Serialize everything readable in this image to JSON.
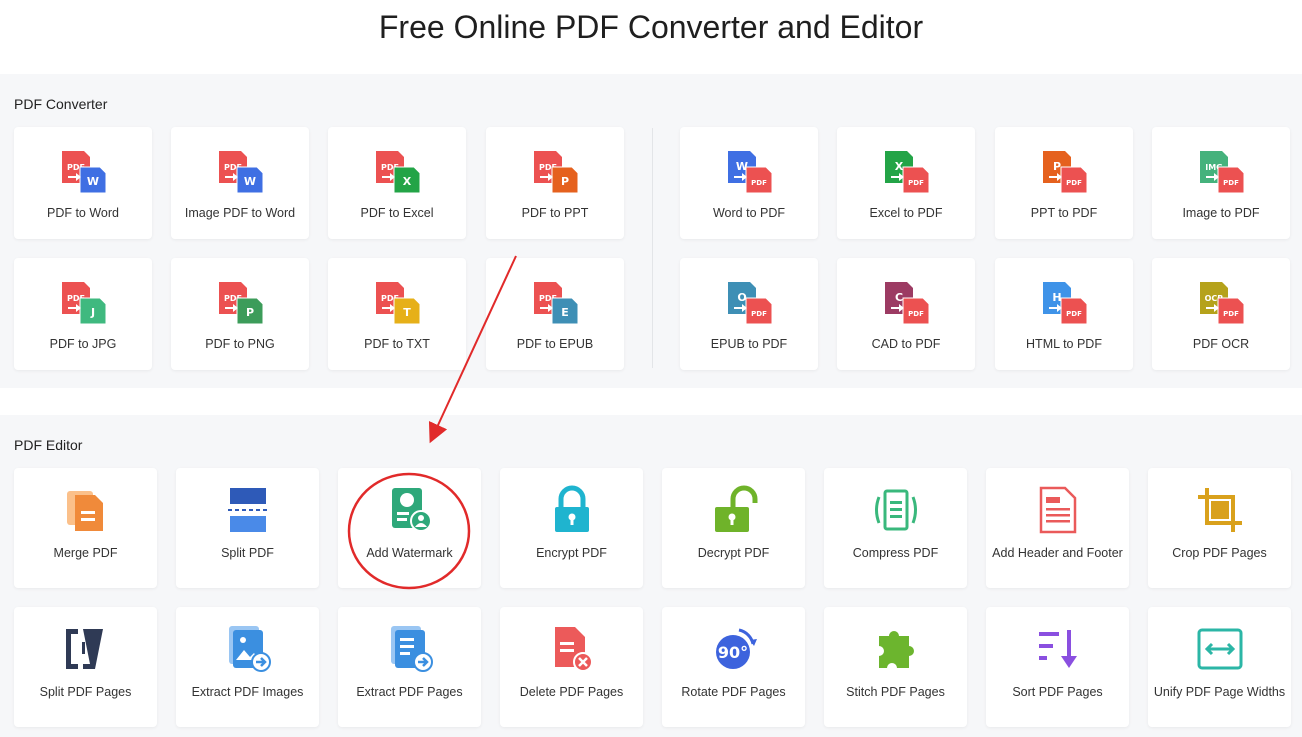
{
  "page": {
    "title": "Free Online PDF Converter and Editor"
  },
  "converter": {
    "title": "PDF Converter",
    "items": [
      {
        "label": "PDF to Word",
        "icon": "pdf-to-word-icon",
        "src": "PDF",
        "dst": "W",
        "dst_color": "#3f6fe3"
      },
      {
        "label": "Image PDF to Word",
        "icon": "image-pdf-to-word-icon",
        "src": "PDF",
        "dst": "W",
        "dst_color": "#3f6fe3"
      },
      {
        "label": "PDF to Excel",
        "icon": "pdf-to-excel-icon",
        "src": "PDF",
        "dst": "X",
        "dst_color": "#23a447"
      },
      {
        "label": "PDF to PPT",
        "icon": "pdf-to-ppt-icon",
        "src": "PDF",
        "dst": "P",
        "dst_color": "#e5611e"
      },
      {
        "label": "Word to PDF",
        "icon": "word-to-pdf-icon",
        "src": "W",
        "src_color": "#3f6fe3",
        "dst": "PDF"
      },
      {
        "label": "Excel to PDF",
        "icon": "excel-to-pdf-icon",
        "src": "X",
        "src_color": "#23a447",
        "dst": "PDF"
      },
      {
        "label": "PPT to PDF",
        "icon": "ppt-to-pdf-icon",
        "src": "P",
        "src_color": "#e5611e",
        "dst": "PDF"
      },
      {
        "label": "Image to PDF",
        "icon": "image-to-pdf-icon",
        "src": "IMG",
        "src_color": "#45b27c",
        "dst": "PDF"
      },
      {
        "label": "PDF to JPG",
        "icon": "pdf-to-jpg-icon",
        "src": "PDF",
        "dst": "J",
        "dst_color": "#3fb97f"
      },
      {
        "label": "PDF to PNG",
        "icon": "pdf-to-png-icon",
        "src": "PDF",
        "dst": "P",
        "dst_color": "#3c9c5a"
      },
      {
        "label": "PDF to TXT",
        "icon": "pdf-to-txt-icon",
        "src": "PDF",
        "dst": "T",
        "dst_color": "#e6b019"
      },
      {
        "label": "PDF to EPUB",
        "icon": "pdf-to-epub-icon",
        "src": "PDF",
        "dst": "E",
        "dst_color": "#3e8fb5"
      },
      {
        "label": "EPUB to PDF",
        "icon": "epub-to-pdf-icon",
        "src": "O",
        "src_color": "#3e8fb5",
        "dst": "PDF"
      },
      {
        "label": "CAD to PDF",
        "icon": "cad-to-pdf-icon",
        "src": "C",
        "src_color": "#9c3b63",
        "dst": "PDF"
      },
      {
        "label": "HTML to PDF",
        "icon": "html-to-pdf-icon",
        "src": "H",
        "src_color": "#3f93e8",
        "dst": "PDF"
      },
      {
        "label": "PDF OCR",
        "icon": "pdf-ocr-icon",
        "src": "OCR",
        "src_color": "#b5a21b",
        "dst": "PDF"
      }
    ]
  },
  "editor": {
    "title": "PDF Editor",
    "items": [
      {
        "label": "Merge PDF",
        "icon": "merge-pdf-icon",
        "color": "#f08a3a"
      },
      {
        "label": "Split PDF",
        "icon": "split-pdf-icon",
        "color": "#2e5ab8"
      },
      {
        "label": "Add Watermark",
        "icon": "add-watermark-icon",
        "color": "#2ea87a"
      },
      {
        "label": "Encrypt PDF",
        "icon": "encrypt-pdf-icon",
        "color": "#1fb4cf"
      },
      {
        "label": "Decrypt PDF",
        "icon": "decrypt-pdf-icon",
        "color": "#6fb32a"
      },
      {
        "label": "Compress PDF",
        "icon": "compress-pdf-icon",
        "color": "#39b87c"
      },
      {
        "label": "Add Header and Footer",
        "icon": "header-footer-icon",
        "color": "#ea5a5a"
      },
      {
        "label": "Crop PDF Pages",
        "icon": "crop-pdf-pages-icon",
        "color": "#d9a11c"
      },
      {
        "label": "Split PDF Pages",
        "icon": "split-pdf-pages-icon",
        "color": "#2f3a55"
      },
      {
        "label": "Extract PDF Images",
        "icon": "extract-pdf-images-icon",
        "color": "#3b8fe0"
      },
      {
        "label": "Extract PDF Pages",
        "icon": "extract-pdf-pages-icon",
        "color": "#3b8fe0"
      },
      {
        "label": "Delete PDF Pages",
        "icon": "delete-pdf-pages-icon",
        "color": "#ec5a5a"
      },
      {
        "label": "Rotate PDF Pages",
        "icon": "rotate-pdf-pages-icon",
        "color": "#3d63dd",
        "badge": "90°"
      },
      {
        "label": "Stitch PDF Pages",
        "icon": "stitch-pdf-pages-icon",
        "color": "#6cb52e"
      },
      {
        "label": "Sort PDF Pages",
        "icon": "sort-pdf-pages-icon",
        "color": "#8a4fe0"
      },
      {
        "label": "Unify PDF Page Widths",
        "icon": "unify-page-widths-icon",
        "color": "#2bb6a6"
      }
    ]
  },
  "colors": {
    "pdf_red": "#ec5151",
    "annotation_red": "#e12a2a",
    "section_bg": "#f6f7f9"
  }
}
